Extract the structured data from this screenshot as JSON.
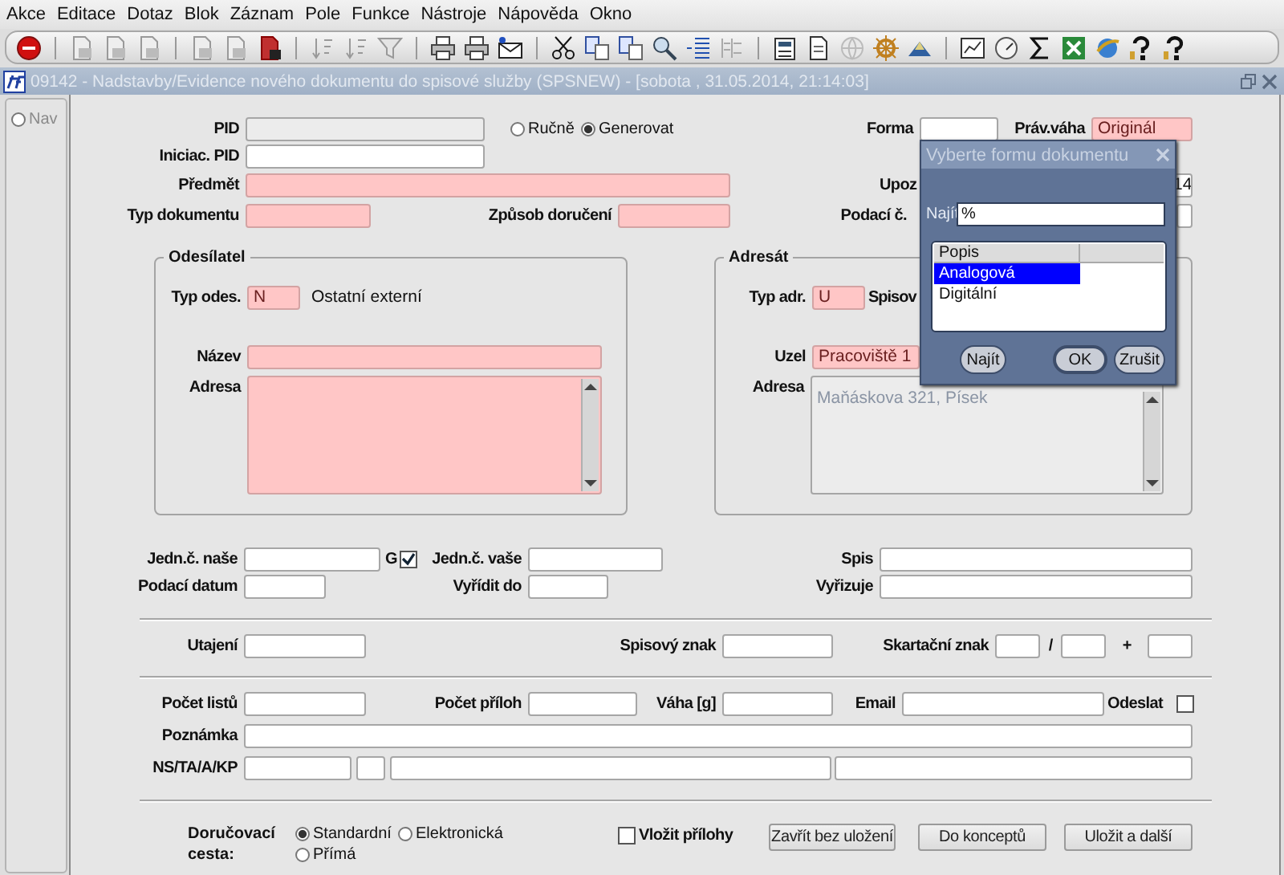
{
  "menu_bar": [
    "Akce",
    "Editace",
    "Dotaz",
    "Blok",
    "Záznam",
    "Pole",
    "Funkce",
    "Nástroje",
    "Nápověda",
    "Okno"
  ],
  "window": {
    "title": "09142 - Nadstavby/Evidence nového dokumentu do spisové služby (SPSNEW) - [sobota , 31.05.2014, 21:14:03]"
  },
  "nav": {
    "label": "Nav",
    "selected": false
  },
  "upper_rows": [
    {
      "items": [
        {
          "kind": "field",
          "label": "PID",
          "required": false,
          "disabled": true
        },
        {
          "kind": "radio",
          "label": "Ručně",
          "selected": false
        },
        {
          "kind": "radio",
          "label": "Generovat",
          "selected": true
        },
        {
          "kind": "field",
          "label": "Forma",
          "required": false,
          "disabled": false
        },
        {
          "kind": "field",
          "label": "Práv.váha",
          "value": "Originál",
          "required": true,
          "disabled": false
        }
      ]
    },
    {
      "items": [
        {
          "kind": "field",
          "label": "Iniciac. PID",
          "required": false,
          "disabled": false
        }
      ]
    },
    {
      "items": [
        {
          "kind": "field",
          "label": "Předmět",
          "required": true,
          "disabled": false
        },
        {
          "kind": "field",
          "label": "Upoz",
          "value": "14",
          "required": false,
          "disabled": false
        }
      ]
    },
    {
      "items": [
        {
          "kind": "field",
          "label": "Typ dokumentu",
          "required": true,
          "disabled": false
        },
        {
          "kind": "field",
          "label": "Způsob doručení",
          "required": true,
          "disabled": false
        },
        {
          "kind": "field",
          "label": "Podací č.",
          "required": false,
          "disabled": false
        }
      ]
    }
  ],
  "groups": [
    {
      "title": "Odesílatel",
      "rows": [
        {
          "items": [
            {
              "kind": "field",
              "label": "Typ odes.",
              "value": "N",
              "required": true,
              "disabled": false
            },
            {
              "kind": "text",
              "label": "Ostatní externí"
            }
          ]
        },
        {
          "items": [
            {
              "kind": "field",
              "label": "Název",
              "required": true,
              "disabled": false
            }
          ]
        },
        {
          "items": [
            {
              "kind": "area",
              "label": "Adresa",
              "required": true,
              "disabled": false
            }
          ]
        }
      ]
    },
    {
      "title": "Adresát",
      "rows": [
        {
          "items": [
            {
              "kind": "field",
              "label": "Typ adr.",
              "value": "U",
              "required": true,
              "disabled": false
            },
            {
              "kind": "label",
              "label": "Spisov"
            }
          ]
        },
        {
          "items": [
            {
              "kind": "field",
              "label": "Uzel",
              "value": "Pracoviště 1",
              "required": true,
              "disabled": false
            }
          ]
        },
        {
          "items": [
            {
              "kind": "area",
              "label": "Adresa",
              "value": "Maňáskova 321, Písek",
              "required": false,
              "disabled": true
            }
          ]
        }
      ]
    }
  ],
  "lower_sections": [
    {
      "rows": [
        {
          "items": [
            {
              "kind": "field",
              "label": "Jedn.č. naše",
              "required": false,
              "disabled": false
            },
            {
              "kind": "check",
              "label": "G",
              "checked": true
            },
            {
              "kind": "field",
              "label": "Jedn.č. vaše",
              "required": false,
              "disabled": false
            },
            {
              "kind": "field",
              "label": "Spis",
              "required": false,
              "disabled": false
            }
          ]
        },
        {
          "items": [
            {
              "kind": "field",
              "label": "Podací datum",
              "required": false,
              "disabled": false
            },
            {
              "kind": "field",
              "label": "Vyřídit do",
              "required": false,
              "disabled": false
            },
            {
              "kind": "field",
              "label": "Vyřizuje",
              "required": false,
              "disabled": false
            }
          ]
        }
      ]
    },
    {
      "rows": [
        {
          "items": [
            {
              "kind": "field",
              "label": "Utajení",
              "required": false,
              "disabled": false
            },
            {
              "kind": "field",
              "label": "Spisový znak",
              "required": false,
              "disabled": false
            },
            {
              "kind": "field",
              "label": "Skartační znak",
              "required": false,
              "disabled": false
            },
            {
              "kind": "label",
              "label": "/"
            },
            {
              "kind": "field",
              "required": false,
              "disabled": false
            },
            {
              "kind": "label",
              "label": "+"
            },
            {
              "kind": "field",
              "required": false,
              "disabled": false
            }
          ]
        }
      ]
    },
    {
      "rows": [
        {
          "items": [
            {
              "kind": "field",
              "label": "Počet listů",
              "required": false,
              "disabled": false
            },
            {
              "kind": "field",
              "label": "Počet příloh",
              "required": false,
              "disabled": false
            },
            {
              "kind": "field",
              "label": "Váha [g]",
              "required": false,
              "disabled": false
            },
            {
              "kind": "field",
              "label": "Email",
              "required": false,
              "disabled": false
            },
            {
              "kind": "check",
              "label": "Odeslat",
              "checked": false
            }
          ]
        },
        {
          "items": [
            {
              "kind": "field",
              "label": "Poznámka",
              "required": false,
              "disabled": false
            }
          ]
        },
        {
          "items": [
            {
              "kind": "field",
              "label": "NS/TA/A/KP",
              "required": false,
              "disabled": false
            },
            {
              "kind": "field",
              "required": false,
              "disabled": false
            },
            {
              "kind": "field",
              "required": false,
              "disabled": false
            },
            {
              "kind": "field",
              "required": false,
              "disabled": false
            }
          ]
        }
      ]
    }
  ],
  "delivery": {
    "label": "Doručovací cesta:",
    "options": [
      {
        "label": "Standardní",
        "selected": true
      },
      {
        "label": "Elektronická",
        "selected": false
      },
      {
        "label": "Přímá",
        "selected": false
      }
    ]
  },
  "attach": {
    "label": "Vložit přílohy",
    "checked": false
  },
  "buttons": [
    "Zavřít bez uložení",
    "Do konceptů",
    "Uložit a další"
  ],
  "dialog": {
    "title": "Vyberte formu dokumentu",
    "search_label": "Najít",
    "search_value": "%",
    "column": "Popis",
    "options": [
      {
        "label": "Analogová",
        "selected": true
      },
      {
        "label": "Digitální",
        "selected": false
      }
    ],
    "buttons": [
      "Najít",
      "OK",
      "Zrušit"
    ]
  }
}
